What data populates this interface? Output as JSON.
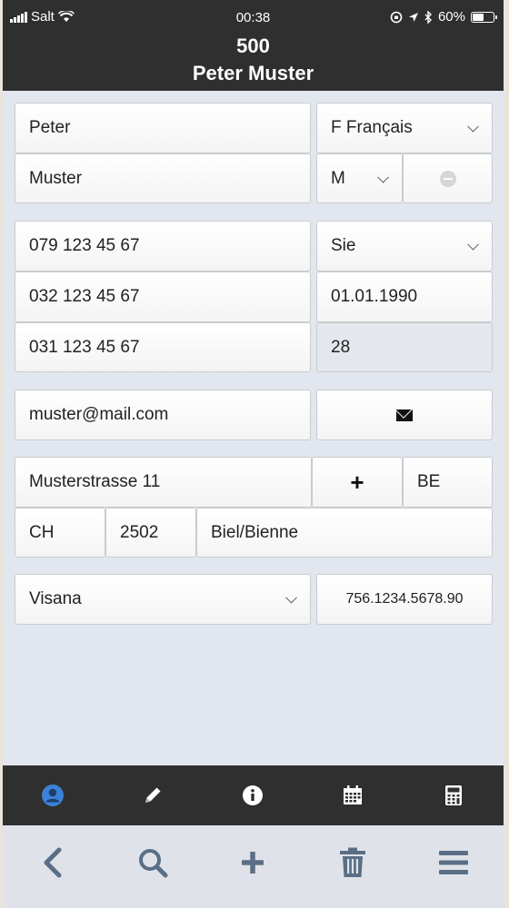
{
  "status": {
    "carrier": "Salt",
    "time": "00:38",
    "battery_pct": "60%",
    "battery_level": 0.6
  },
  "header": {
    "number": "500",
    "name": "Peter Muster"
  },
  "form": {
    "first_name": "Peter",
    "language": "F Français",
    "last_name": "Muster",
    "gender": "M",
    "phone_mobile": "079 123 45 67",
    "salutation": "Sie",
    "phone_work": "032 123 45 67",
    "birth_date": "01.01.1990",
    "phone_home": "031 123 45 67",
    "age": "28",
    "email": "muster@mail.com",
    "street": "Musterstrasse 11",
    "canton": "BE",
    "country": "CH",
    "zip": "2502",
    "city": "Biel/Bienne",
    "insurance": "Visana",
    "ahv_number": "756.1234.5678.90"
  },
  "tabs": [
    {
      "icon": "person-icon",
      "active": true
    },
    {
      "icon": "pencil-icon",
      "active": false
    },
    {
      "icon": "info-icon",
      "active": false
    },
    {
      "icon": "calendar-icon",
      "active": false
    },
    {
      "icon": "calculator-icon",
      "active": false
    }
  ],
  "toolbar": [
    "back-icon",
    "search-icon",
    "plus-icon",
    "trash-icon",
    "menu-icon"
  ],
  "colors": {
    "header_bg": "#2f2f2f",
    "page_bg": "#e2e7ef",
    "active_tab": "#3b82d6",
    "toolbar_icon": "#5a6f86"
  }
}
